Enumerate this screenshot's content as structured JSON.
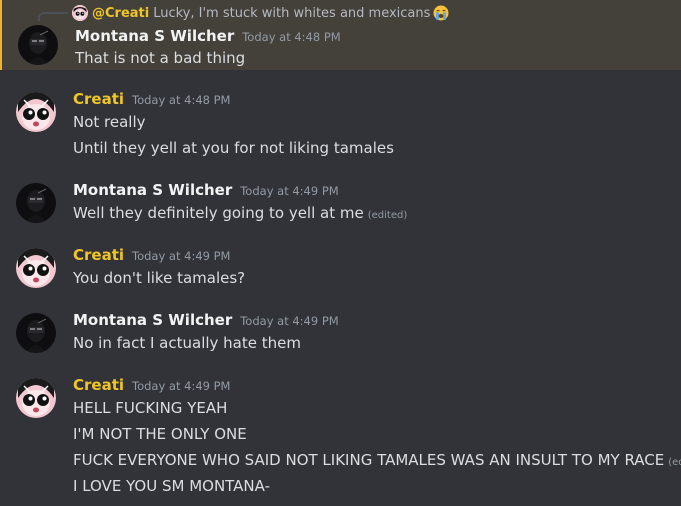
{
  "reply": {
    "author": "@Creati",
    "text": "Lucky, I'm stuck with whites and mexicans",
    "emoji": "loudly-crying-face"
  },
  "messages": [
    {
      "author": "Montana S Wilcher",
      "timestamp": "Today at 4:48 PM",
      "lines": [
        "That is not a bad thing"
      ]
    },
    {
      "author": "Creati",
      "timestamp": "Today at 4:48 PM",
      "lines": [
        "Not really",
        "Until they yell at you for not liking tamales"
      ]
    },
    {
      "author": "Montana S Wilcher",
      "timestamp": "Today at 4:49 PM",
      "lines": [
        "Well they definitely going to yell at me"
      ],
      "edited_label": "(edited)"
    },
    {
      "author": "Creati",
      "timestamp": "Today at 4:49 PM",
      "lines": [
        "You don't like tamales?"
      ]
    },
    {
      "author": "Montana S Wilcher",
      "timestamp": "Today at 4:49 PM",
      "lines": [
        "No in fact I actually hate them"
      ]
    },
    {
      "author": "Creati",
      "timestamp": "Today at 4:49 PM",
      "lines": [
        "HELL FUCKING YEAH",
        "I'M NOT THE ONLY ONE",
        "FUCK EVERYONE WHO SAID NOT LIKING TAMALES WAS AN INSULT TO MY RACE",
        "I LOVE YOU SM MONTANA-"
      ],
      "edited_label": "(edited)"
    }
  ],
  "colors": {
    "background": "#313338",
    "highlight": "#44403a",
    "highlight_bar": "#f0b132",
    "creati_name": "#f0c528",
    "montana_name": "#f2f3f5",
    "text": "#dbdee1",
    "muted": "#949ba4"
  }
}
